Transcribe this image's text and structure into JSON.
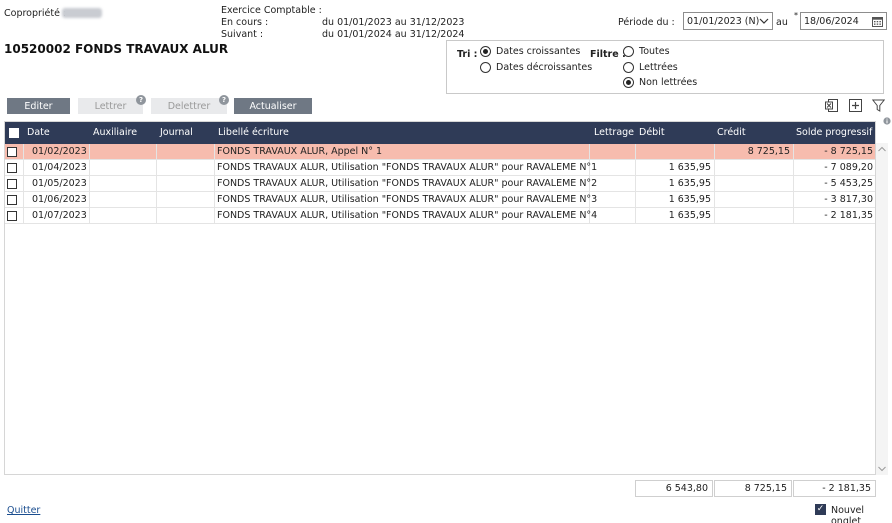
{
  "header": {
    "copro_label": "Copropriété :",
    "exercice_title": "Exercice Comptable :",
    "en_cours_label": "En cours :",
    "en_cours_value": "du 01/01/2023 au 31/12/2023",
    "suivant_label": "Suivant :",
    "suivant_value": "du 01/01/2024 au 31/12/2024",
    "account_title": "10520002 FONDS TRAVAUX ALUR"
  },
  "periode": {
    "label": "Période du :",
    "from": "01/01/2023 (N)",
    "au_label": "au",
    "required_mark": "*",
    "to": "18/06/2024"
  },
  "tri": {
    "label": "Tri :",
    "options": [
      {
        "label": "Dates croissantes",
        "selected": true
      },
      {
        "label": "Dates décroissantes",
        "selected": false
      }
    ]
  },
  "filtre": {
    "label": "Filtre :",
    "options": [
      {
        "label": "Toutes",
        "selected": false
      },
      {
        "label": "Lettrées",
        "selected": false
      },
      {
        "label": "Non lettrées",
        "selected": true
      }
    ]
  },
  "toolbar": {
    "editer": "Editer",
    "lettrer": "Lettrer",
    "delettrer": "Delettrer",
    "actualiser": "Actualiser",
    "help_glyph": "?"
  },
  "grid": {
    "columns": {
      "date": "Date",
      "auxiliaire": "Auxiliaire",
      "journal": "Journal",
      "libelle": "Libellé écriture",
      "lettrage": "Lettrage",
      "debit": "Débit",
      "credit": "Crédit",
      "solde": "Solde progressif"
    },
    "rows": [
      {
        "date": "01/02/2023",
        "auxiliaire": "",
        "journal": "",
        "libelle": "FONDS TRAVAUX ALUR, Appel N° 1",
        "lettrage": "",
        "debit": "",
        "credit": "8 725,15",
        "solde": "- 8 725,15"
      },
      {
        "date": "01/04/2023",
        "auxiliaire": "",
        "journal": "",
        "libelle": "FONDS TRAVAUX ALUR, Utilisation \"FONDS TRAVAUX ALUR\" pour RAVALEME N°1",
        "lettrage": "",
        "debit": "1 635,95",
        "credit": "",
        "solde": "- 7 089,20"
      },
      {
        "date": "01/05/2023",
        "auxiliaire": "",
        "journal": "",
        "libelle": "FONDS TRAVAUX ALUR, Utilisation \"FONDS TRAVAUX ALUR\" pour RAVALEME N°2",
        "lettrage": "",
        "debit": "1 635,95",
        "credit": "",
        "solde": "- 5 453,25"
      },
      {
        "date": "01/06/2023",
        "auxiliaire": "",
        "journal": "",
        "libelle": "FONDS TRAVAUX ALUR, Utilisation \"FONDS TRAVAUX ALUR\" pour RAVALEME N°3",
        "lettrage": "",
        "debit": "1 635,95",
        "credit": "",
        "solde": "- 3 817,30"
      },
      {
        "date": "01/07/2023",
        "auxiliaire": "",
        "journal": "",
        "libelle": "FONDS TRAVAUX ALUR, Utilisation \"FONDS TRAVAUX ALUR\" pour RAVALEME N°4",
        "lettrage": "",
        "debit": "1 635,95",
        "credit": "",
        "solde": "- 2 181,35"
      }
    ],
    "totals": {
      "debit": "6 543,80",
      "credit": "8 725,15",
      "solde": "- 2 181,35"
    }
  },
  "footer": {
    "quit": "Quitter",
    "new_tab_label": "Nouvel onglet",
    "new_tab_checked": true,
    "checkmark": "✓"
  },
  "colors": {
    "header_bg": "#2f3b57",
    "selected_row": "#f7bcae",
    "button": "#6f7884"
  }
}
